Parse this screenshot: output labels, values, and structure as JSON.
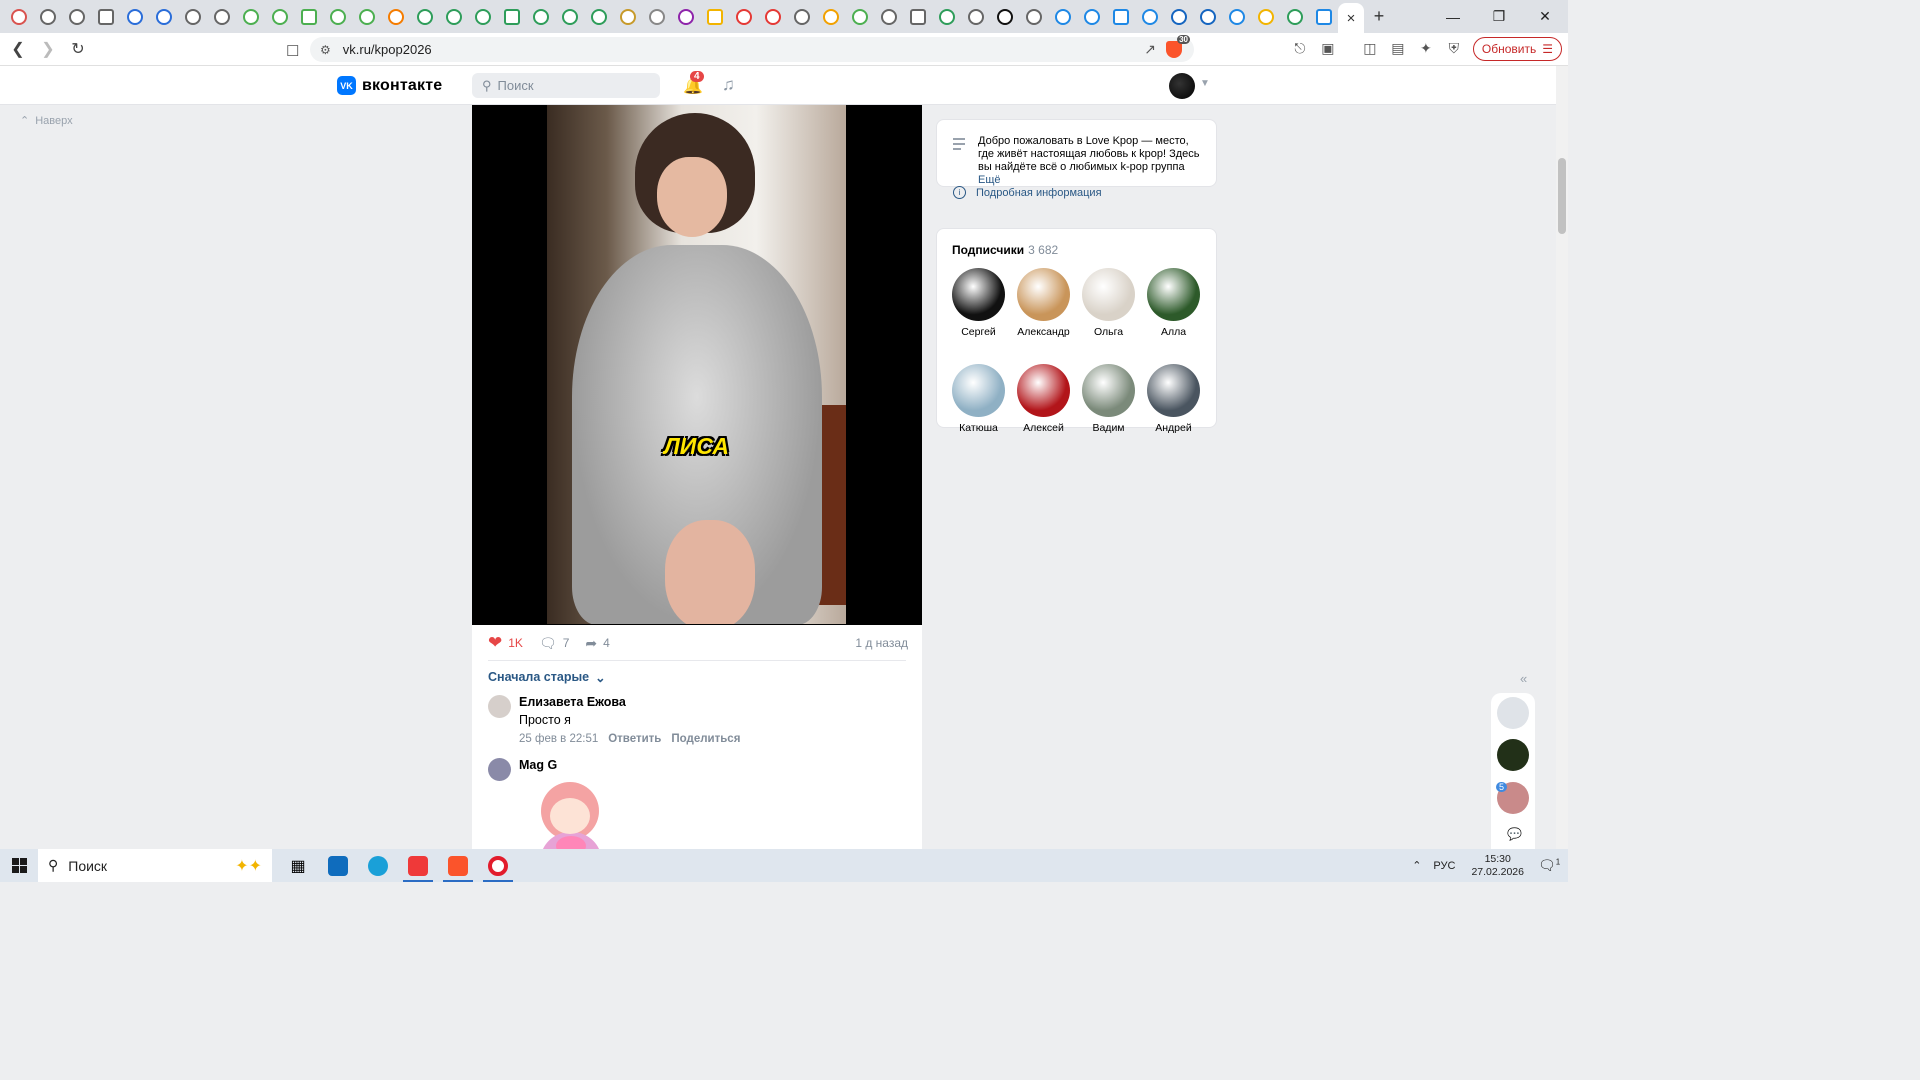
{
  "browser": {
    "tabs_count": 46,
    "new_tab_label": "+",
    "close_tab_glyph": "×",
    "window_controls": [
      "—",
      "❐",
      "✕"
    ],
    "url": "vk.ru/kpop2026",
    "shields_count": "30",
    "update_label": "Обновить"
  },
  "vk": {
    "logo_text": "вконтакте",
    "logo_mark": "VK",
    "search_placeholder": "Поиск",
    "notifications_count": "4",
    "up_label": "Наверх"
  },
  "post": {
    "video_caption": "ЛИСА",
    "likes": "1K",
    "comments": "7",
    "shares": "4",
    "time_ago": "1 д назад",
    "sort_label": "Сначала старые"
  },
  "comments": [
    {
      "author": "Елизавета Ежова",
      "text": "Просто я",
      "date": "25 фев в 22:51",
      "reply_label": "Ответить",
      "share_label": "Поделиться"
    },
    {
      "author": "Mag G",
      "text": "",
      "sticker": "anime-girl-heart-sticker"
    }
  ],
  "community": {
    "description": "Добро пожаловать в Love Kpop — место, где живёт настоящая любовь к kpop! Здесь вы найдёте всё о любимых k-pop группа",
    "more_label": "Ещё",
    "info_label": "Подробная информация"
  },
  "subscribers": {
    "title": "Подписчики",
    "count": "3 682",
    "members": [
      {
        "name": "Сергей",
        "color": "#111111"
      },
      {
        "name": "Александр",
        "color": "#c9955a"
      },
      {
        "name": "Ольга",
        "color": "#d9d2c8"
      },
      {
        "name": "Алла",
        "color": "#2d5a2a"
      },
      {
        "name": "Катюша",
        "color": "#8fb0c4"
      },
      {
        "name": "Алексей",
        "color": "#b2151a"
      },
      {
        "name": "Вадим",
        "color": "#7b8a7a"
      },
      {
        "name": "Андрей",
        "color": "#4a5560"
      }
    ]
  },
  "mini_sidebar": {
    "badge": "5"
  },
  "taskbar": {
    "search_placeholder": "Поиск",
    "lang": "РУС",
    "time": "15:30",
    "date": "27.02.2026",
    "notif_count": "1"
  }
}
